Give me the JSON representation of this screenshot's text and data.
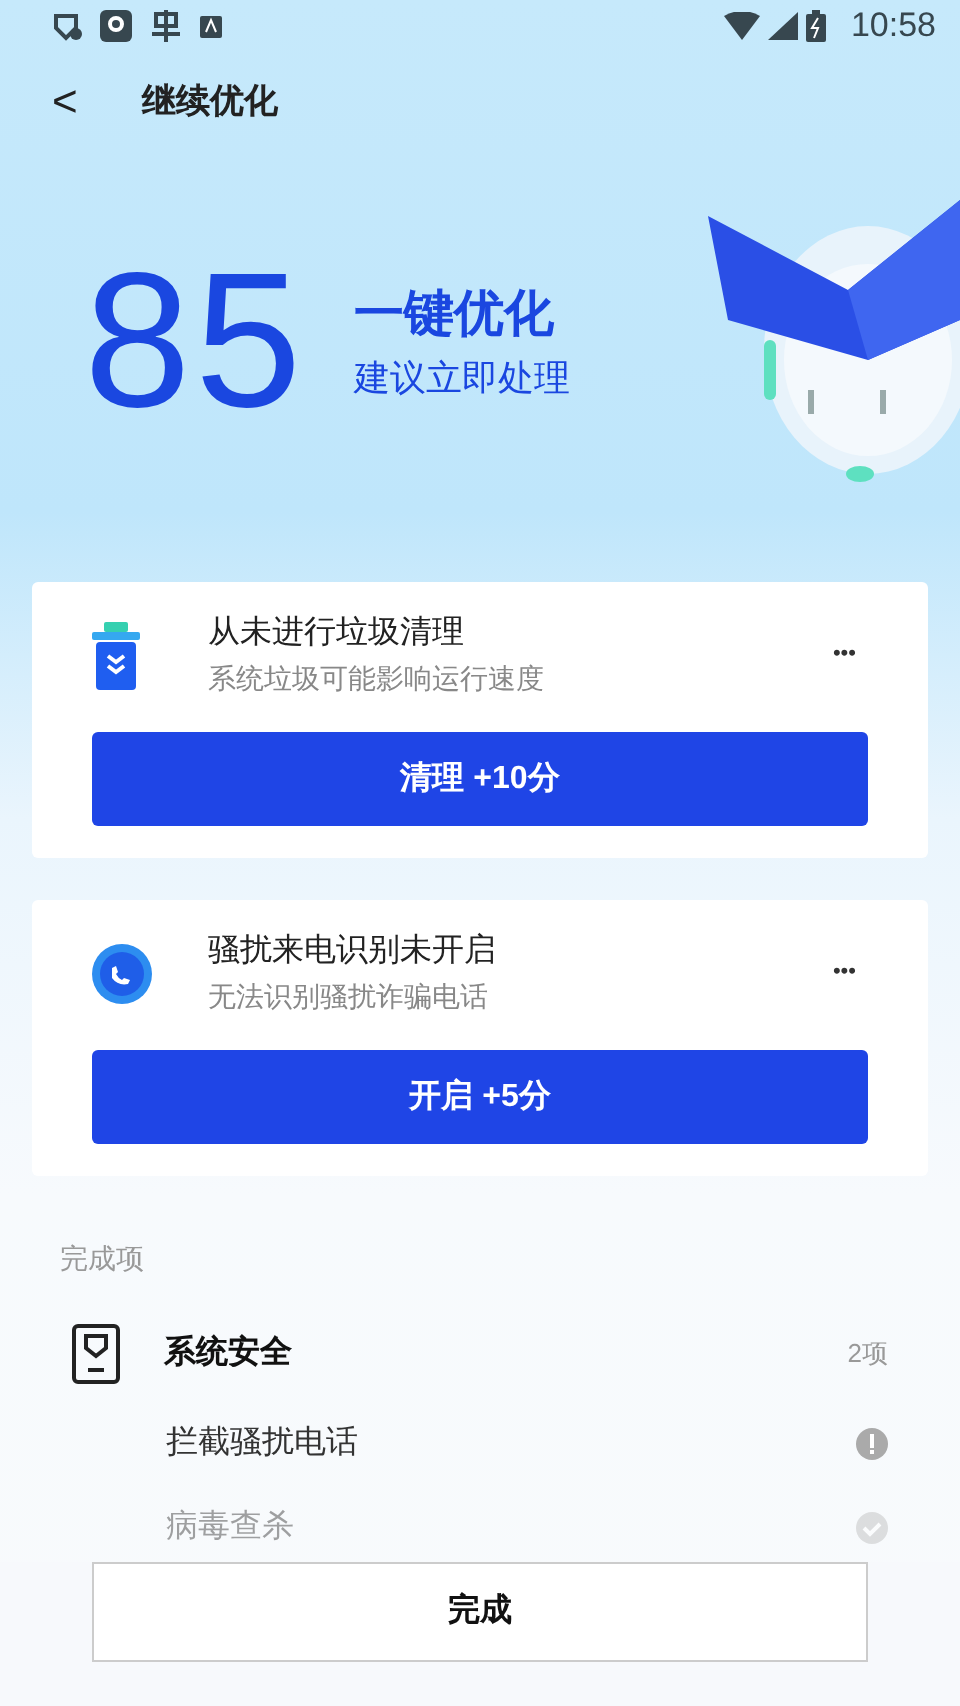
{
  "status_bar": {
    "time": "10:58"
  },
  "header": {
    "back": "<",
    "title": "继续优化"
  },
  "score": {
    "value": "85",
    "title": "一键优化",
    "subtitle": "建议立即处理"
  },
  "tasks": [
    {
      "kind": "trash",
      "title": "从未进行垃圾清理",
      "subtitle": "系统垃圾可能影响运行速度",
      "more": "•••",
      "button": "清理 +10分"
    },
    {
      "kind": "phone",
      "title": "骚扰来电识别未开启",
      "subtitle": "无法识别骚扰诈骗电话",
      "more": "•••",
      "button": "开启 +5分"
    }
  ],
  "completed": {
    "heading": "完成项",
    "groups": [
      {
        "title": "系统安全",
        "count": "2项",
        "items": [
          {
            "label": "拦截骚扰电话",
            "kind": "warning"
          },
          {
            "label": "病毒查杀",
            "kind": "done"
          }
        ]
      }
    ]
  },
  "footer": {
    "button": "完成"
  }
}
